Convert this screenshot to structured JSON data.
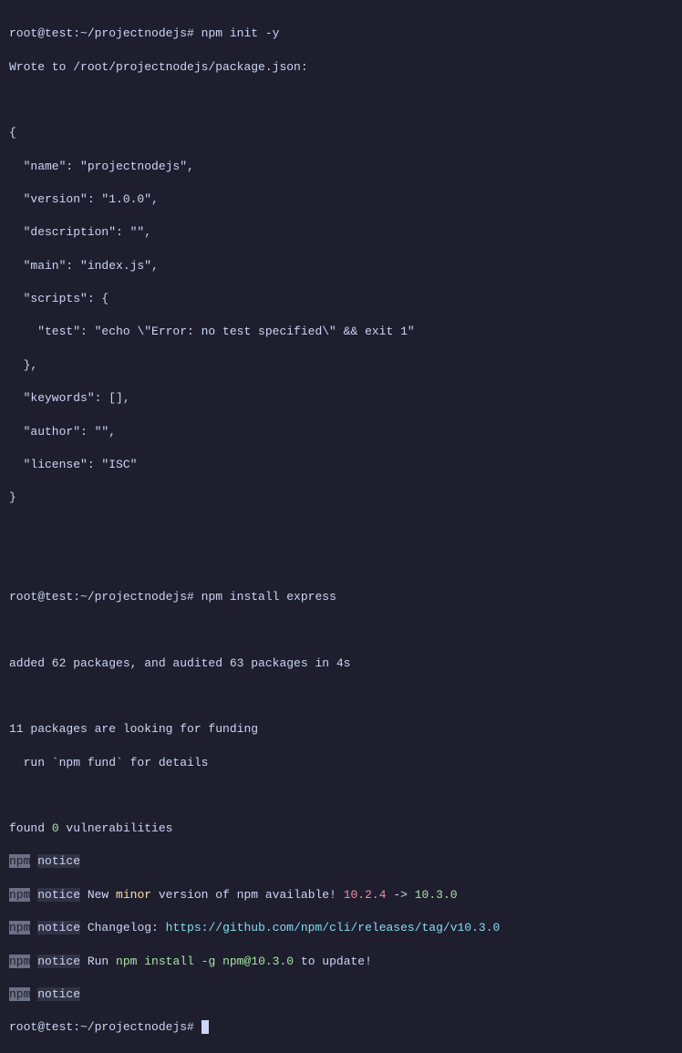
{
  "prompt1": "root@test:~/projectnodejs# ",
  "cmd1": "npm init -y",
  "line_wrote": "Wrote to /root/projectnodejs/package.json:",
  "json_open": "{",
  "json_name": "  \"name\": \"projectnodejs\",",
  "json_version": "  \"version\": \"1.0.0\",",
  "json_desc": "  \"description\": \"\",",
  "json_main": "  \"main\": \"index.js\",",
  "json_scripts": "  \"scripts\": {",
  "json_test": "    \"test\": \"echo \\\"Error: no test specified\\\" && exit 1\"",
  "json_scripts_close": "  },",
  "json_keywords": "  \"keywords\": [],",
  "json_author": "  \"author\": \"\",",
  "json_license": "  \"license\": \"ISC\"",
  "json_close": "}",
  "prompt2": "root@test:~/projectnodejs# ",
  "cmd2": "npm install express",
  "added_line": "added 62 packages, and audited 63 packages in 4s",
  "funding1": "11 packages are looking for funding",
  "funding2": "  run `npm fund` for details",
  "found_prefix": "found ",
  "found_zero": "0",
  "found_suffix": " vulnerabilities",
  "npm_label": "npm",
  "notice_label": "notice",
  "notice1_a": " New ",
  "notice1_b": "minor",
  "notice1_c": " version of npm available! ",
  "notice1_d": "10.2.4",
  "notice1_e": " -> ",
  "notice1_f": "10.3.0",
  "notice2_a": " Changelog: ",
  "notice2_b": "https://github.com/npm/cli/releases/tag/v10.3.0",
  "notice3_a": " Run ",
  "notice3_b": "npm install -g npm@10.3.0",
  "notice3_c": " to update!",
  "prompt3": "root@test:~/projectnodejs# "
}
